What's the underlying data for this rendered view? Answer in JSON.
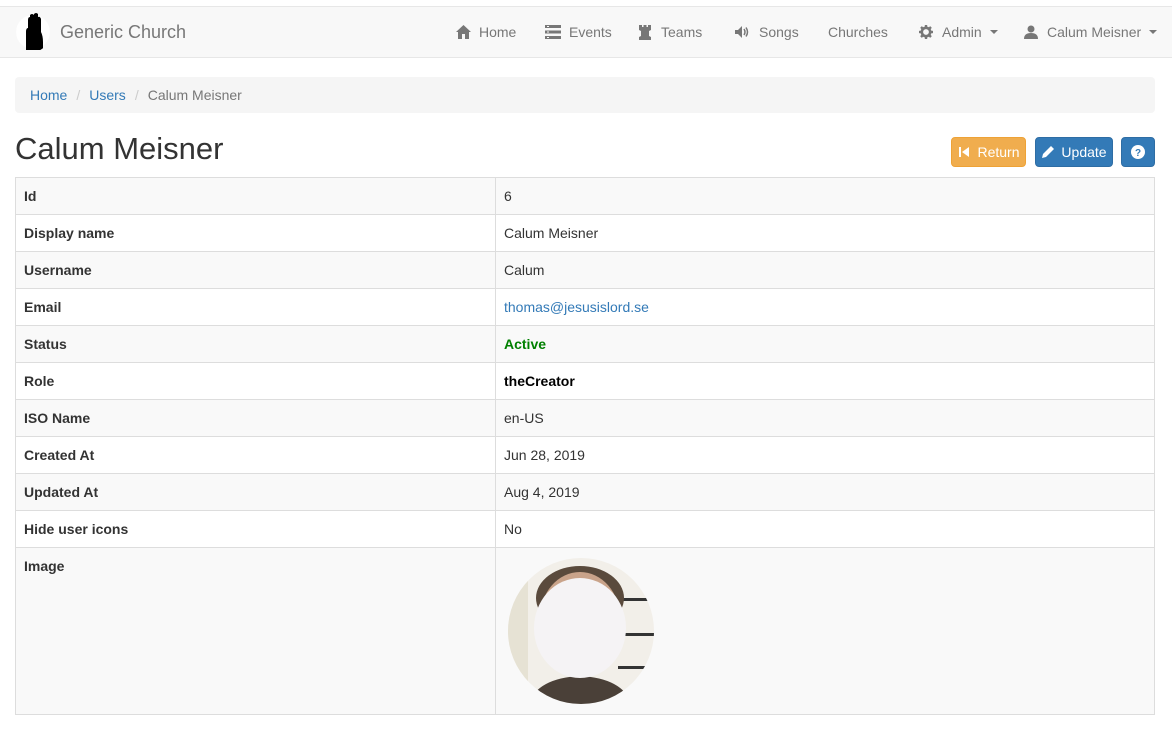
{
  "brand": {
    "name": "Generic Church"
  },
  "nav": {
    "home": "Home",
    "events": "Events",
    "teams": "Teams",
    "songs": "Songs",
    "churches": "Churches",
    "admin": "Admin",
    "user": "Calum Meisner"
  },
  "breadcrumb": {
    "home": "Home",
    "users": "Users",
    "current": "Calum Meisner"
  },
  "page": {
    "title": "Calum Meisner"
  },
  "actions": {
    "return": "Return",
    "update": "Update"
  },
  "details": {
    "rows": [
      {
        "label": "Id",
        "value": "6"
      },
      {
        "label": "Display name",
        "value": "Calum Meisner"
      },
      {
        "label": "Username",
        "value": "Calum"
      },
      {
        "label": "Email",
        "value": "thomas@jesusislord.se"
      },
      {
        "label": "Status",
        "value": "Active"
      },
      {
        "label": "Role",
        "value": "theCreator"
      },
      {
        "label": "ISO Name",
        "value": "en-US"
      },
      {
        "label": "Created At",
        "value": "Jun 28, 2019"
      },
      {
        "label": "Updated At",
        "value": "Aug 4, 2019"
      },
      {
        "label": "Hide user icons",
        "value": "No"
      },
      {
        "label": "Image",
        "value": ""
      }
    ]
  },
  "colors": {
    "link": "#337ab7",
    "status_active": "#008000",
    "warning": "#f0ad4e",
    "primary": "#337ab7"
  },
  "icons": [
    "praying-hands-icon",
    "home-icon",
    "events-list-icon",
    "teams-tower-icon",
    "volume-icon",
    "gear-icon",
    "user-icon",
    "step-backward-icon",
    "pencil-icon",
    "question-circle-icon"
  ]
}
